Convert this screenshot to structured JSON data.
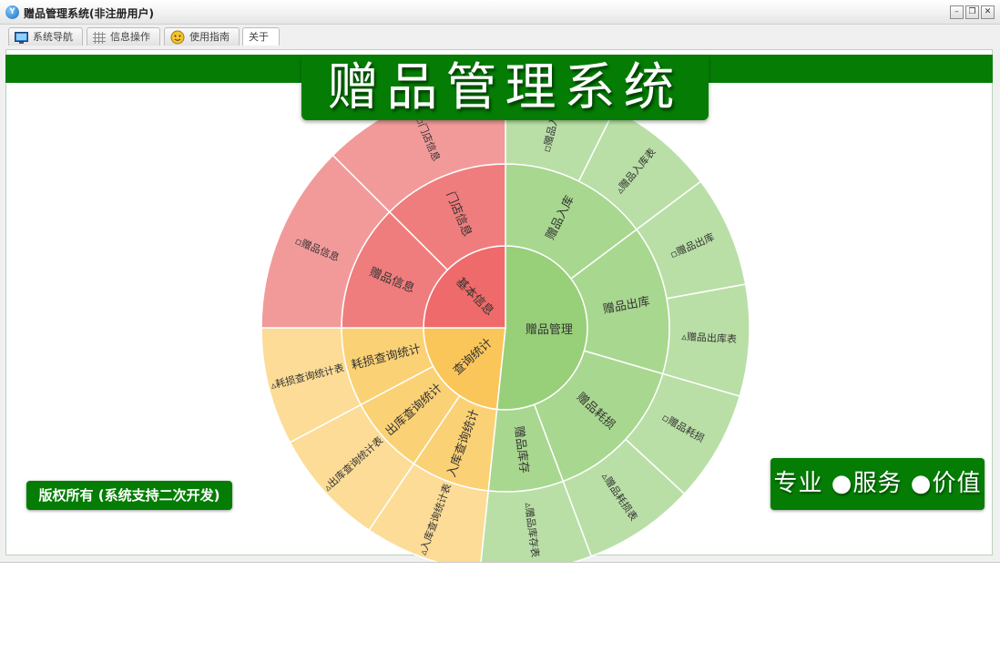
{
  "window": {
    "title": "赠品管理系统(非注册用户)"
  },
  "tabs": [
    {
      "label": "系统导航",
      "icon": "monitor-icon"
    },
    {
      "label": "信息操作",
      "icon": "grid-icon"
    },
    {
      "label": "使用指南",
      "icon": "help-face-icon"
    },
    {
      "label": "关于"
    }
  ],
  "header": {
    "title": "赠品管理系统"
  },
  "footer": {
    "copyright": "版权所有 (系统支持二次开发)",
    "slogan": "专业 ●服务 ●价值"
  },
  "colors": {
    "brand_green": "#057d05",
    "red": [
      "#ef6a6a",
      "#ef7d7d",
      "#f29a9a"
    ],
    "orange": [
      "#fac65a",
      "#fbd175",
      "#fcdc96"
    ],
    "green": [
      "#98cf79",
      "#a8d78f",
      "#b9dfa6"
    ]
  },
  "menu_tree": [
    {
      "label": "赠品管理",
      "level_color": "green",
      "children": [
        {
          "label": "赠品入库",
          "children": [
            {
              "label": "▫赠品入库"
            },
            {
              "label": "▵赠品入库表"
            }
          ]
        },
        {
          "label": "赠品出库",
          "children": [
            {
              "label": "▫赠品出库"
            },
            {
              "label": "▵赠品出库表"
            }
          ]
        },
        {
          "label": "赠品耗损",
          "children": [
            {
              "label": "▫赠品耗损"
            },
            {
              "label": "▵赠品耗损表"
            }
          ]
        },
        {
          "label": "赠品库存",
          "children": [
            {
              "label": "▵赠品库存表"
            }
          ]
        }
      ]
    },
    {
      "label": "查询统计",
      "level_color": "orange",
      "children": [
        {
          "label": "入库查询统计",
          "children": [
            {
              "label": "▵入库查询统计表"
            }
          ]
        },
        {
          "label": "出库查询统计",
          "children": [
            {
              "label": "▵出库查询统计表"
            }
          ]
        },
        {
          "label": "耗损查询统计",
          "children": [
            {
              "label": "▵耗损查询统计表"
            }
          ]
        }
      ]
    },
    {
      "label": "基本信息",
      "level_color": "red",
      "children": [
        {
          "label": "赠品信息",
          "children": [
            {
              "label": "▫赠品信息"
            }
          ]
        },
        {
          "label": "门店信息",
          "children": [
            {
              "label": "▫门店信息"
            }
          ]
        }
      ]
    }
  ]
}
